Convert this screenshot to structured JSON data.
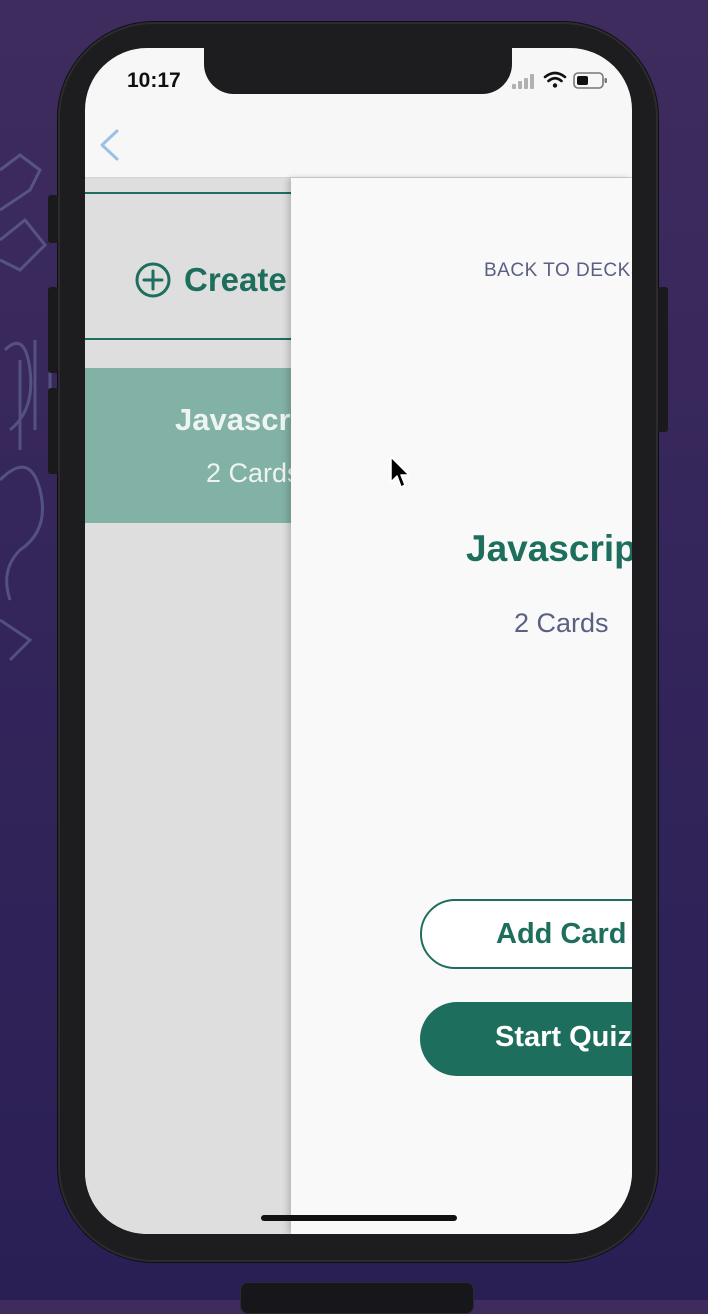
{
  "status_bar": {
    "time": "10:17"
  },
  "nav": {
    "back_icon": "chevron-left-icon"
  },
  "deck_list": {
    "create_icon": "plus-circle-icon",
    "create_label": "Create",
    "deck": {
      "title": "Javascrip",
      "count": "2 Cards"
    }
  },
  "deck_detail": {
    "back_link": "BACK TO DECKS",
    "title": "Javascript",
    "count": "2 Cards",
    "add_card_label": "Add Card",
    "start_quiz_label": "Start Quiz"
  },
  "colors": {
    "accent": "#1e6e5e",
    "text_secondary": "#5a5f84",
    "deck_tile": "#82b1a6",
    "background": "#3a2a5c"
  }
}
